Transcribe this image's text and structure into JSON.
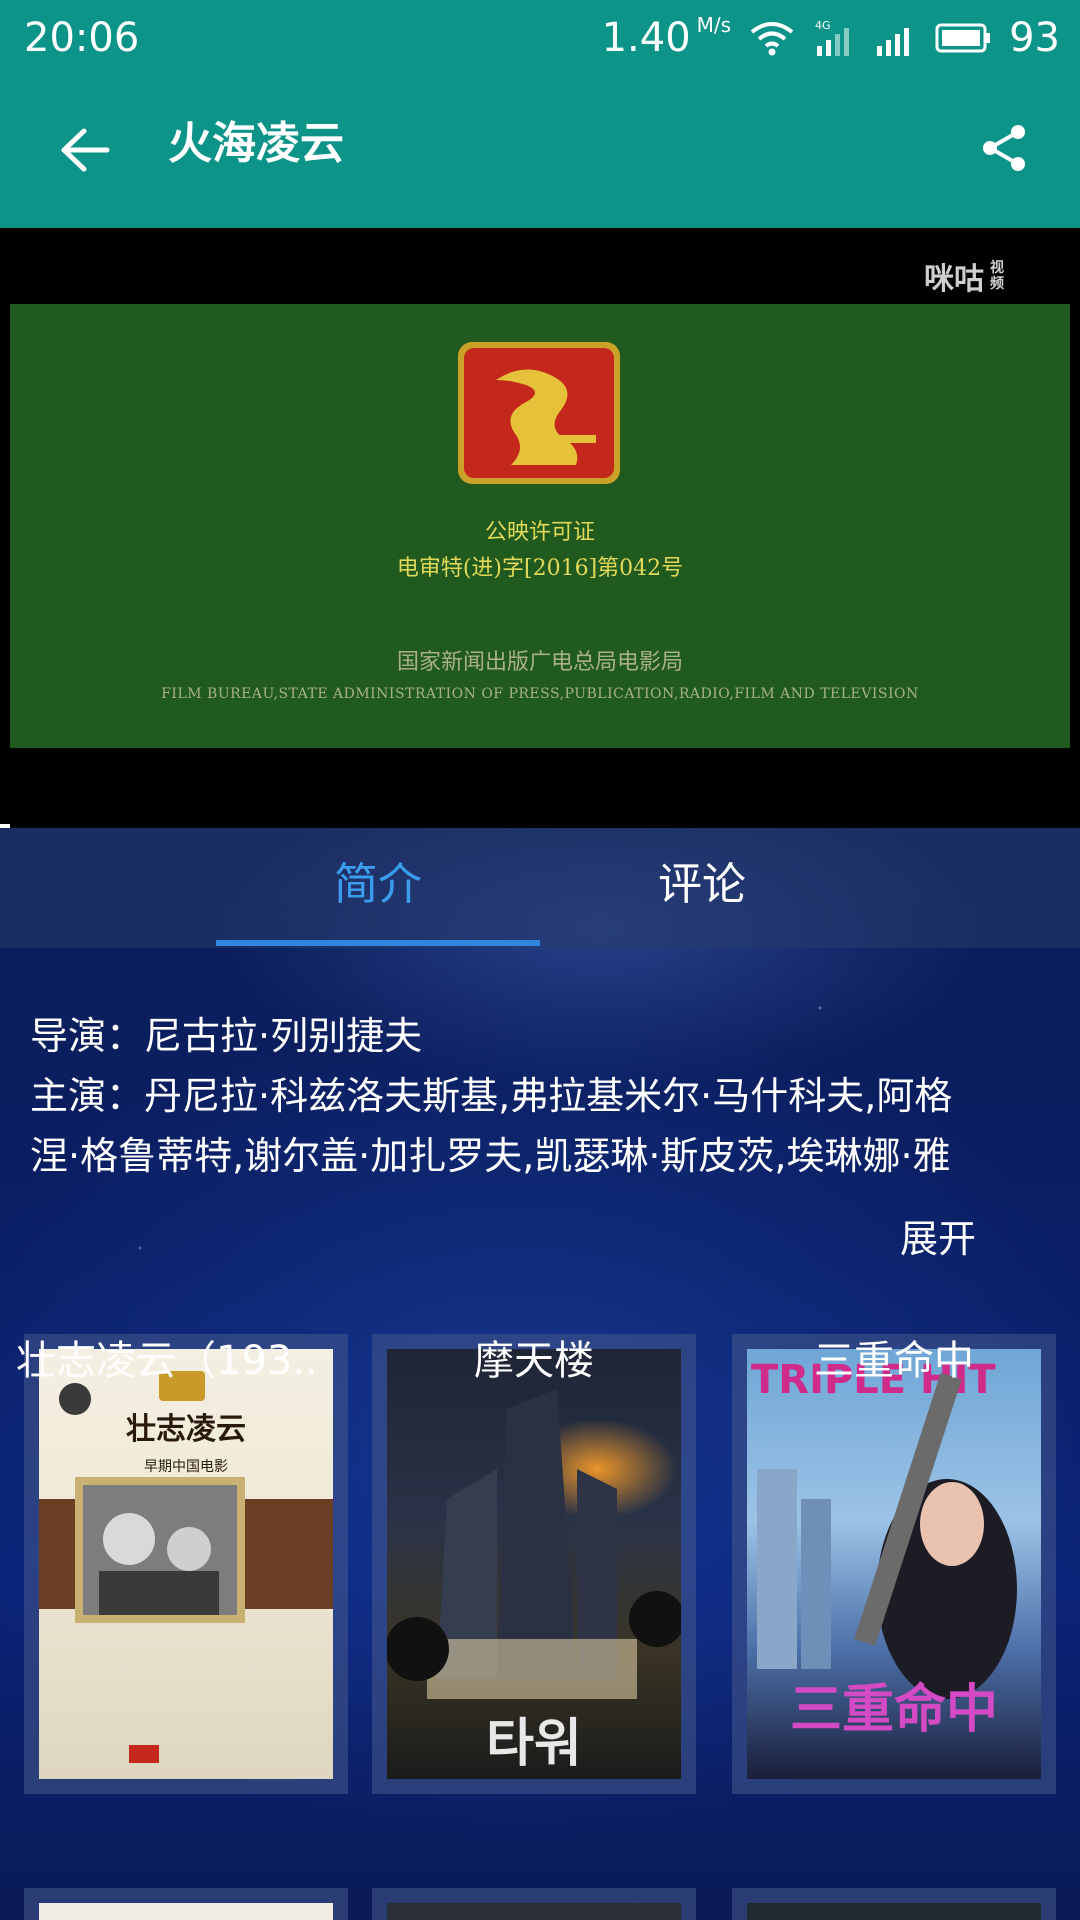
{
  "status_bar": {
    "time": "20:06",
    "speed": "1.40",
    "speed_unit": "M/s",
    "network": "4G",
    "battery": "93"
  },
  "app_bar": {
    "title": "火海凌云"
  },
  "video": {
    "watermark": "咪咕",
    "watermark_sub": "视频",
    "license_title": "公映许可证",
    "license_number": "电审特(进)字[2016]第042号",
    "bureau_cn": "国家新闻出版广电总局电影局",
    "bureau_en": "FILM BUREAU,STATE ADMINISTRATION OF PRESS,PUBLICATION,RADIO,FILM AND TELEVISION"
  },
  "tabs": [
    {
      "label": "简介"
    },
    {
      "label": "评论"
    }
  ],
  "info": {
    "line1": "导演：尼古拉·列别捷夫",
    "line2": "主演：丹尼拉·科兹洛夫斯基,弗拉基米尔·马什科夫,阿格",
    "line3": "涅·格鲁蒂特,谢尔盖·加扎罗夫,凯瑟琳·斯皮茨,埃琳娜·雅",
    "expand": "展开"
  },
  "recommendations": [
    {
      "title": "壮志凌云（193..",
      "poster_heading": "壮志凌云",
      "poster_sub": "早期中国电影"
    },
    {
      "title": "摩天楼",
      "poster_heading": "타워"
    },
    {
      "title": "三重命中",
      "poster_heading": "TRIPLE HIT",
      "poster_sub": "三重命中"
    }
  ],
  "colors": {
    "teal": "#0d9488",
    "active_tab": "#3b9ded",
    "tab_indicator": "#2e86de",
    "license_gold": "#e2d85a"
  }
}
